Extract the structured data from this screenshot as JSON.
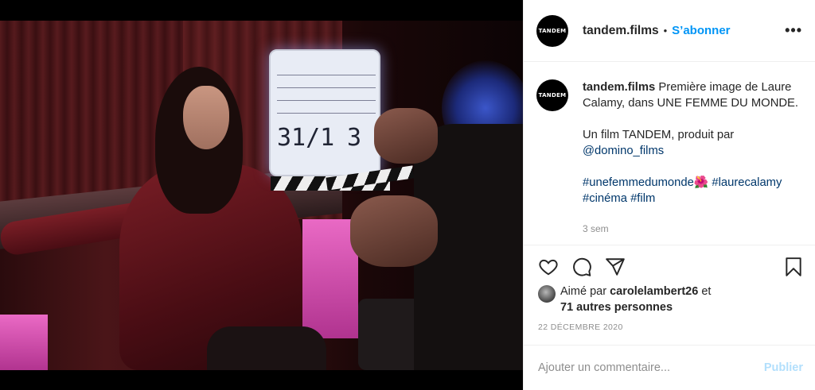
{
  "header": {
    "username": "tandem.films",
    "avatar_text": "TANDEM",
    "separator": "•",
    "follow_label": "S’abonner",
    "more_label": "•••"
  },
  "caption": {
    "username": "tandem.films",
    "line1": "Première image de Laure Calamy, dans UNE FEMME DU MONDE.",
    "line2_prefix": "Un film TANDEM, produit par",
    "mention": "@domino_films",
    "hashtag1": "#unefemmedumonde🌺",
    "hashtag2": "#laurecalamy",
    "hashtag3": "#cinéma",
    "hashtag4": "#film",
    "timestamp": "3 sem"
  },
  "actions": {
    "like_icon": "heart-icon",
    "comment_icon": "comment-icon",
    "share_icon": "paper-plane-icon",
    "save_icon": "bookmark-icon"
  },
  "likes": {
    "prefix": "Aimé par",
    "user": "carolelambert26",
    "conj": "et",
    "others": "71 autres personnes"
  },
  "date": "22 DÉCEMBRE 2020",
  "comment": {
    "placeholder": "Ajouter un commentaire...",
    "publish_label": "Publier"
  },
  "media": {
    "clapper_roll": "31/1",
    "clapper_take": "3"
  },
  "colors": {
    "link_blue": "#0095f6",
    "hashtag_blue": "#00376b",
    "publish_disabled": "#b2dffc",
    "muted": "#8e8e8e"
  }
}
